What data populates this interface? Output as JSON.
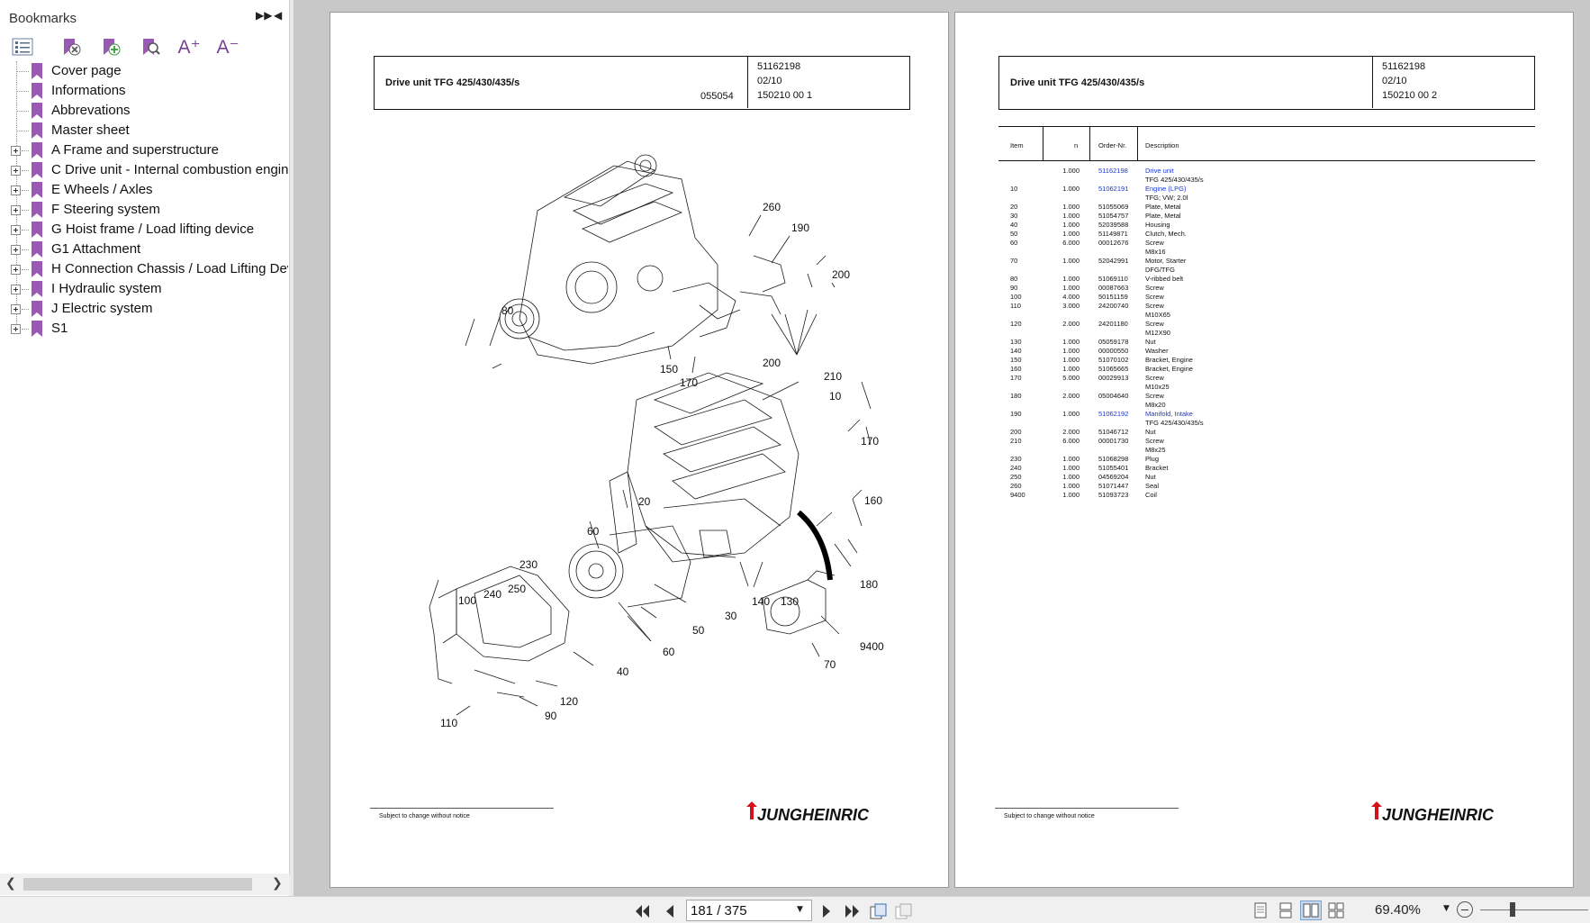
{
  "bookmarks": {
    "title": "Bookmarks",
    "items": [
      {
        "label": "Cover page",
        "expandable": false
      },
      {
        "label": "Informations",
        "expandable": false
      },
      {
        "label": "Abbrevations",
        "expandable": false
      },
      {
        "label": "Master sheet",
        "expandable": false
      },
      {
        "label": "A Frame and superstructure",
        "expandable": true
      },
      {
        "label": "C Drive unit - Internal combustion engine",
        "expandable": true
      },
      {
        "label": "E Wheels / Axles",
        "expandable": true
      },
      {
        "label": "F Steering system",
        "expandable": true
      },
      {
        "label": "G Hoist frame / Load lifting device",
        "expandable": true
      },
      {
        "label": "G1 Attachment",
        "expandable": true
      },
      {
        "label": "H Connection Chassis / Load Lifting Device",
        "expandable": true
      },
      {
        "label": "I Hydraulic system",
        "expandable": true
      },
      {
        "label": "J Electric system",
        "expandable": true
      },
      {
        "label": "S1",
        "expandable": true
      }
    ],
    "tools": [
      {
        "name": "expand-collapse-icon"
      },
      {
        "name": "delete-bookmark-icon"
      },
      {
        "name": "add-bookmark-icon"
      },
      {
        "name": "find-bookmark-icon"
      },
      {
        "name": "increase-text-size-icon",
        "text": "A⁺"
      },
      {
        "name": "decrease-text-size-icon",
        "text": "A⁻"
      }
    ]
  },
  "pages": {
    "left": {
      "title": "Drive unit TFG 425/430/435/s",
      "drawing_no": "055054",
      "part_no": "51162198",
      "date": "02/10",
      "sheet": "150210 00 1",
      "footer": "Subject to change without notice",
      "brand": "JUNGHEINRICH",
      "callouts": [
        "260",
        "190",
        "200",
        "80",
        "150",
        "170",
        "200",
        "210",
        "10",
        "170",
        "20",
        "160",
        "60",
        "230",
        "240",
        "250",
        "100",
        "30",
        "140",
        "130",
        "180",
        "50",
        "60",
        "9400",
        "70",
        "40",
        "120",
        "90",
        "110"
      ]
    },
    "right": {
      "title": "Drive unit TFG 425/430/435/s",
      "part_no": "51162198",
      "date": "02/10",
      "sheet": "150210 00 2",
      "footer": "Subject to change without notice",
      "brand": "JUNGHEINRICH",
      "table": {
        "headers": {
          "item": "Item",
          "qty": "n",
          "order": "Order-Nr.",
          "desc": "Description"
        },
        "rows": [
          {
            "item": "",
            "qty": "1.000",
            "order": "51162198",
            "desc": "Drive unit",
            "link": true
          },
          {
            "item": "",
            "qty": "",
            "order": "",
            "desc": "TFG 425/430/435/s"
          },
          {
            "item": "10",
            "qty": "1.000",
            "order": "51062191",
            "desc": "Engine (LPG)",
            "link": true
          },
          {
            "item": "",
            "qty": "",
            "order": "",
            "desc": "TFG; VW; 2.0l"
          },
          {
            "item": "20",
            "qty": "1.000",
            "order": "51055069",
            "desc": "Plate, Metal"
          },
          {
            "item": "30",
            "qty": "1.000",
            "order": "51054757",
            "desc": "Plate, Metal"
          },
          {
            "item": "40",
            "qty": "1.000",
            "order": "52039588",
            "desc": "Housing"
          },
          {
            "item": "50",
            "qty": "1.000",
            "order": "51149871",
            "desc": "Clutch, Mech."
          },
          {
            "item": "60",
            "qty": "6.000",
            "order": "00012676",
            "desc": "Screw"
          },
          {
            "item": "",
            "qty": "",
            "order": "",
            "desc": "M8x16"
          },
          {
            "item": "70",
            "qty": "1.000",
            "order": "52042991",
            "desc": "Motor, Starter"
          },
          {
            "item": "",
            "qty": "",
            "order": "",
            "desc": "DFG/TFG"
          },
          {
            "item": "80",
            "qty": "1.000",
            "order": "51069110",
            "desc": "V-ribbed belt"
          },
          {
            "item": "90",
            "qty": "1.000",
            "order": "00087663",
            "desc": "Screw"
          },
          {
            "item": "100",
            "qty": "4.000",
            "order": "50151159",
            "desc": "Screw"
          },
          {
            "item": "110",
            "qty": "3.000",
            "order": "24200740",
            "desc": "Screw"
          },
          {
            "item": "",
            "qty": "",
            "order": "",
            "desc": "M10X65"
          },
          {
            "item": "120",
            "qty": "2.000",
            "order": "24201180",
            "desc": "Screw"
          },
          {
            "item": "",
            "qty": "",
            "order": "",
            "desc": "M12X90"
          },
          {
            "item": "130",
            "qty": "1.000",
            "order": "05059178",
            "desc": "Nut"
          },
          {
            "item": "140",
            "qty": "1.000",
            "order": "00000550",
            "desc": "Washer"
          },
          {
            "item": "150",
            "qty": "1.000",
            "order": "51070102",
            "desc": "Bracket, Engine"
          },
          {
            "item": "160",
            "qty": "1.000",
            "order": "51065665",
            "desc": "Bracket, Engine"
          },
          {
            "item": "170",
            "qty": "5.000",
            "order": "00029913",
            "desc": "Screw"
          },
          {
            "item": "",
            "qty": "",
            "order": "",
            "desc": "M10x25"
          },
          {
            "item": "180",
            "qty": "2.000",
            "order": "05004640",
            "desc": "Screw"
          },
          {
            "item": "",
            "qty": "",
            "order": "",
            "desc": "M8x20"
          },
          {
            "item": "190",
            "qty": "1.000",
            "order": "51062192",
            "desc": "Manifold, Intake",
            "link": true
          },
          {
            "item": "",
            "qty": "",
            "order": "",
            "desc": "TFG 425/430/435/s"
          },
          {
            "item": "200",
            "qty": "2.000",
            "order": "51046712",
            "desc": "Nut"
          },
          {
            "item": "210",
            "qty": "6.000",
            "order": "00001730",
            "desc": "Screw"
          },
          {
            "item": "",
            "qty": "",
            "order": "",
            "desc": "M8x25"
          },
          {
            "item": "230",
            "qty": "1.000",
            "order": "51068298",
            "desc": "Plug"
          },
          {
            "item": "240",
            "qty": "1.000",
            "order": "51055401",
            "desc": "Bracket"
          },
          {
            "item": "250",
            "qty": "1.000",
            "order": "04569204",
            "desc": "Nut"
          },
          {
            "item": "260",
            "qty": "1.000",
            "order": "51071447",
            "desc": "Seal"
          },
          {
            "item": "9400",
            "qty": "1.000",
            "order": "51093723",
            "desc": "Coil"
          }
        ]
      }
    }
  },
  "status": {
    "page_value": "181 / 375",
    "zoom": "69.40%",
    "zoom_level_percent": 30
  },
  "colors": {
    "accent": "#e8731d",
    "link": "#1a35d6",
    "bookmark_icon": "#9b59b6",
    "brand_red": "#d4121b"
  }
}
